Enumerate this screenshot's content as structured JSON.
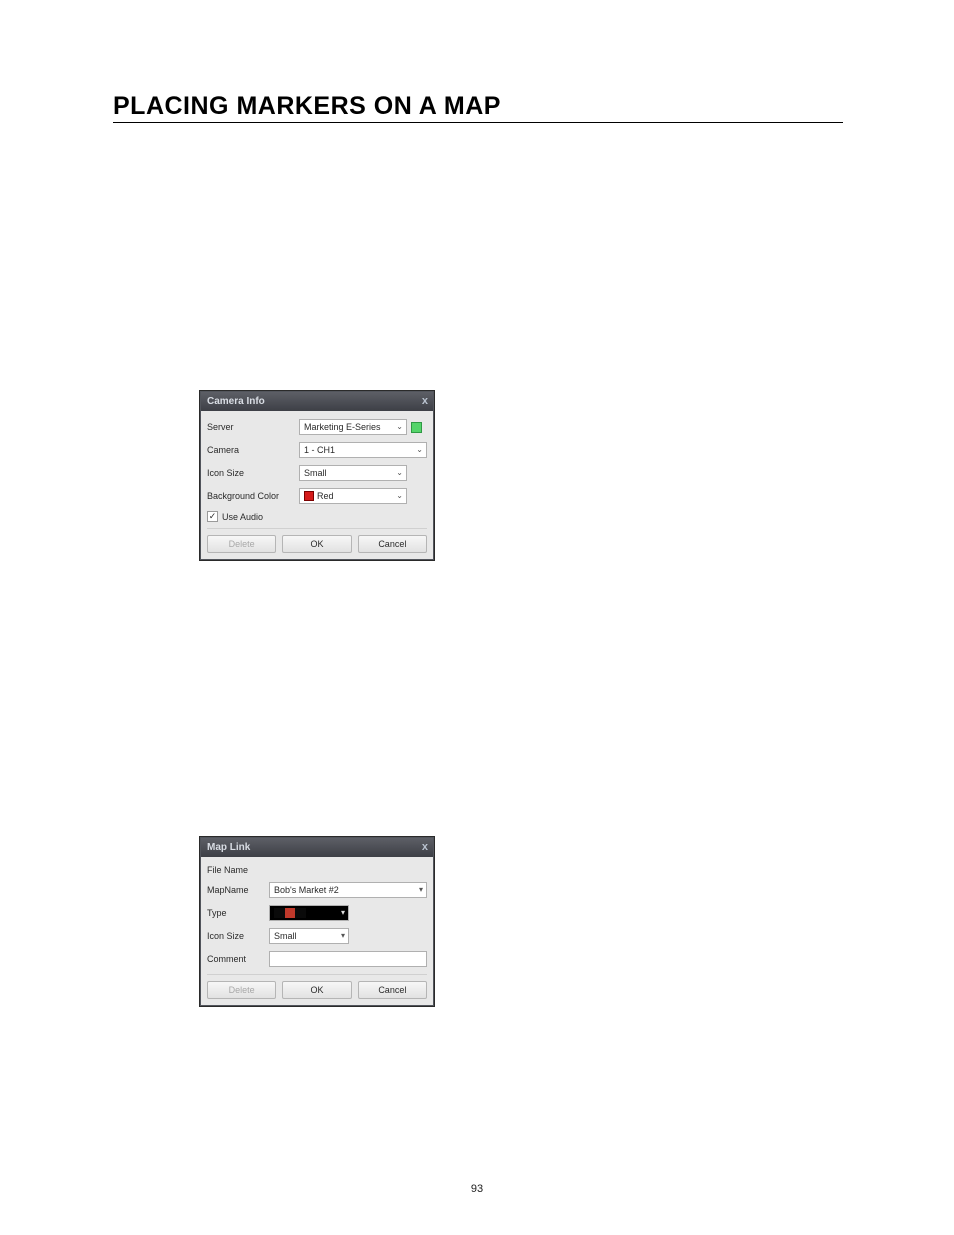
{
  "page": {
    "title": "PLACING MARKERS ON A MAP",
    "number": "93"
  },
  "camera_info": {
    "title": "Camera Info",
    "close": "x",
    "labels": {
      "server": "Server",
      "camera": "Camera",
      "icon_size": "Icon Size",
      "bg_color": "Background Color",
      "use_audio": "Use Audio"
    },
    "values": {
      "server": "Marketing E-Series",
      "camera": "1 - CH1",
      "icon_size": "Small",
      "bg_color": "Red",
      "use_audio_checked": "✓"
    },
    "buttons": {
      "delete": "Delete",
      "ok": "OK",
      "cancel": "Cancel"
    }
  },
  "map_link": {
    "title": "Map Link",
    "close": "x",
    "labels": {
      "file_name": "File Name",
      "map_name": "MapName",
      "type": "Type",
      "icon_size": "Icon Size",
      "comment": "Comment"
    },
    "values": {
      "file_name": "",
      "map_name": "Bob's Market #2",
      "icon_size": "Small",
      "comment": ""
    },
    "buttons": {
      "delete": "Delete",
      "ok": "OK",
      "cancel": "Cancel"
    }
  }
}
